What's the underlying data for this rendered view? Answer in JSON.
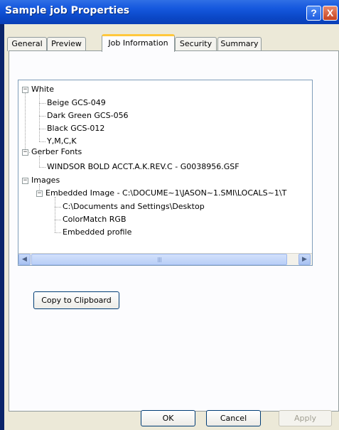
{
  "window": {
    "title": "Sample job Properties",
    "help_glyph": "?",
    "close_glyph": "X"
  },
  "tabs": [
    {
      "label": "General",
      "active": false
    },
    {
      "label": "Preview",
      "active": false
    },
    {
      "label": "Job Information",
      "active": true
    },
    {
      "label": "Security",
      "active": false
    },
    {
      "label": "Summary",
      "active": false
    }
  ],
  "tree": {
    "expander_minus": "−",
    "nodes": [
      {
        "label": "White",
        "level": 0,
        "expander": "minus"
      },
      {
        "label": "Beige GCS-049",
        "level": 1
      },
      {
        "label": "Dark Green GCS-056",
        "level": 1
      },
      {
        "label": "Black GCS-012",
        "level": 1
      },
      {
        "label": "Y,M,C,K",
        "level": 1
      },
      {
        "label": "Gerber Fonts",
        "level": 0,
        "expander": "minus"
      },
      {
        "label": "WINDSOR BOLD ACCT.A.K.REV.C - G0038956.GSF",
        "level": 1
      },
      {
        "label": "Images",
        "level": 0,
        "expander": "minus"
      },
      {
        "label": "Embedded Image - C:\\DOCUME~1\\JASON~1.SMI\\LOCALS~1\\T",
        "level": 1,
        "expander": "minus"
      },
      {
        "label": "C:\\Documents and Settings\\Desktop",
        "level": 2
      },
      {
        "label": "ColorMatch RGB",
        "level": 2
      },
      {
        "label": "Embedded profile",
        "level": 2
      }
    ]
  },
  "scrollbar": {
    "left_arrow": "◀",
    "right_arrow": "▶"
  },
  "buttons": {
    "copy_to_clipboard": "Copy to Clipboard",
    "ok": "OK",
    "cancel": "Cancel",
    "apply": "Apply"
  },
  "colors": {
    "title_bar": "#0b48c8",
    "active_tab_accent": "#ffc83c",
    "dialog_face": "#ece9d8"
  }
}
